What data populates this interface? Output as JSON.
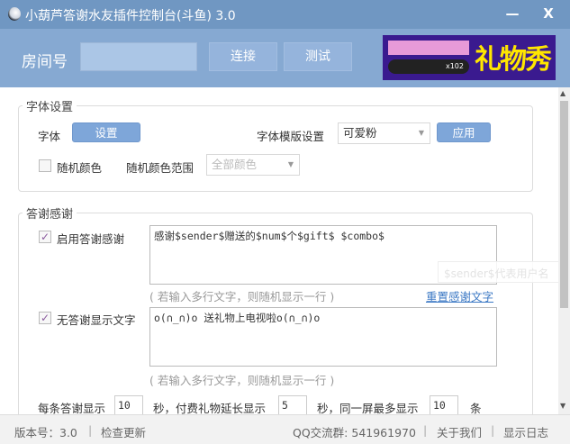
{
  "window": {
    "title": "小葫芦答谢水友插件控制台(斗鱼) 3.0",
    "minimize": "—",
    "close": "X"
  },
  "header": {
    "room_label": "房间号",
    "room_value": "",
    "connect": "连接",
    "test": "测试",
    "banner_text": "礼物秀",
    "banner_count": "x102"
  },
  "font_group": {
    "legend": "字体设置",
    "font_label": "字体",
    "set_button": "设置",
    "template_label": "字体模版设置",
    "template_value": "可爱粉",
    "apply_button": "应用",
    "random_color_label": "随机颜色",
    "random_color_checked": false,
    "range_label": "随机颜色范围",
    "range_value": "全部颜色"
  },
  "thanks_group": {
    "legend": "答谢感谢",
    "enable_label": "启用答谢感谢",
    "enable_checked": true,
    "thanks_text": "感谢$sender$赠送的$num$个$gift$ $combo$",
    "hint1": "( 若输入多行文字，则随机显示一行 )",
    "reset_link": "重置感谢文字",
    "no_thanks_label": "无答谢显示文字",
    "no_thanks_checked": true,
    "no_thanks_text": "o(∩_∩)o 送礼物上电视啦o(∩_∩)o",
    "hint2": "( 若输入多行文字，则随机显示一行 )",
    "duration_pre": "每条答谢显示",
    "duration": "10",
    "duration_mid": "秒，付费礼物延长显示",
    "extend": "5",
    "extend_mid": "秒，同一屏最多显示",
    "max": "10",
    "max_post": "条",
    "tooltip": "$sender$代表用户名"
  },
  "footer": {
    "version": "版本号：3.0",
    "check_update": "检查更新",
    "qq_group": "QQ交流群: 541961970",
    "about": "关于我们",
    "show_log": "显示日志",
    "sep": "|"
  }
}
